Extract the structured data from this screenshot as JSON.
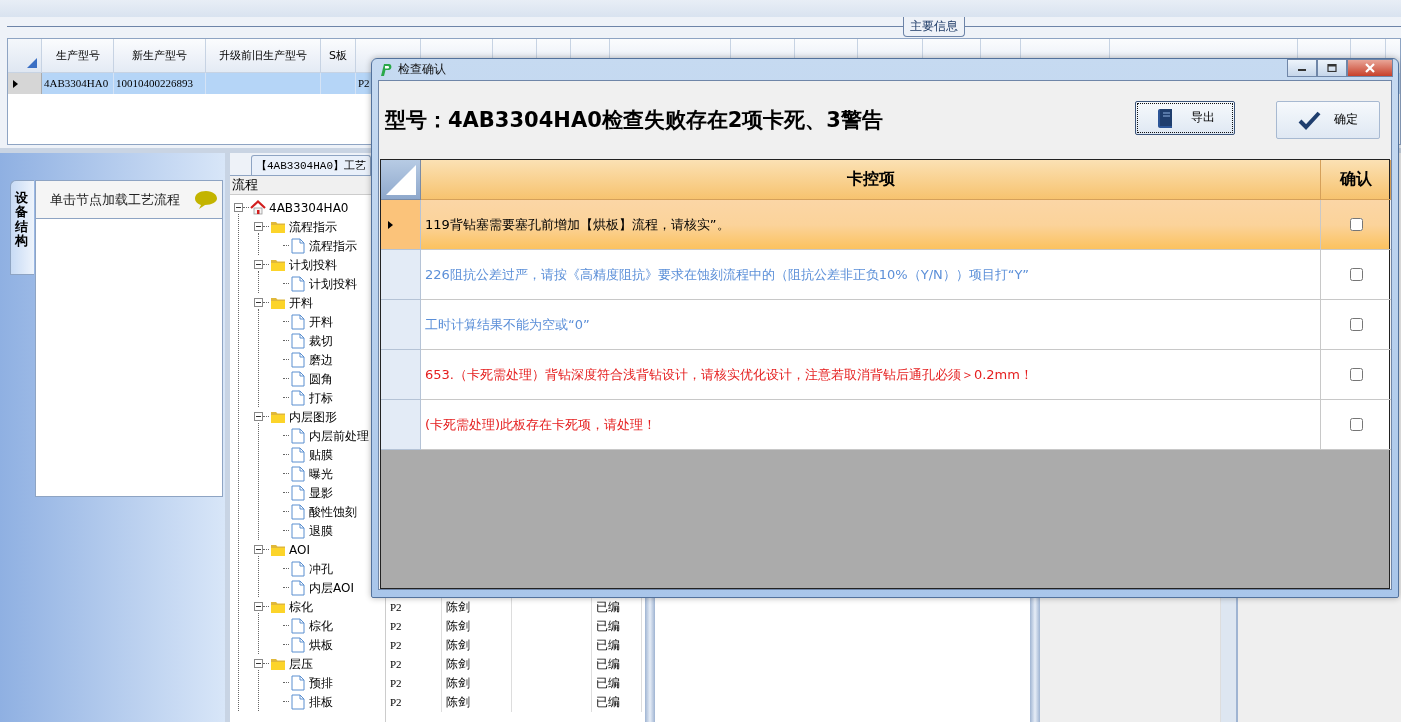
{
  "main_info": {
    "title": "主要信息",
    "columns": [
      "生产型号",
      "新生产型号",
      "升级前旧生产型号",
      "S板"
    ],
    "rows": [
      {
        "selected": true,
        "cells": [
          "4AB3304HA0",
          "10010400226893",
          "",
          "",
          "P2"
        ]
      }
    ]
  },
  "side_tab": {
    "label": "设备结构"
  },
  "node_panel": {
    "hint": "单击节点加载工艺流程"
  },
  "process_tab": {
    "label": "【4AB3304HA0】工艺"
  },
  "tree": {
    "header": "流程",
    "nodes": [
      {
        "label": "4AB3304HA0",
        "kind": "root",
        "expanded": true,
        "children": [
          {
            "label": "流程指示",
            "kind": "group",
            "expanded": true,
            "children": [
              {
                "label": "流程指示",
                "kind": "step"
              }
            ]
          },
          {
            "label": "计划投料",
            "kind": "group",
            "expanded": true,
            "children": [
              {
                "label": "计划投料",
                "kind": "step"
              }
            ]
          },
          {
            "label": "开料",
            "kind": "group",
            "expanded": true,
            "children": [
              {
                "label": "开料",
                "kind": "step"
              },
              {
                "label": "裁切",
                "kind": "step"
              },
              {
                "label": "磨边",
                "kind": "step"
              },
              {
                "label": "圆角",
                "kind": "step"
              },
              {
                "label": "打标",
                "kind": "step"
              }
            ]
          },
          {
            "label": "内层图形",
            "kind": "group",
            "expanded": true,
            "children": [
              {
                "label": "内层前处理",
                "kind": "step"
              },
              {
                "label": "贴膜",
                "kind": "step"
              },
              {
                "label": "曝光",
                "kind": "step"
              },
              {
                "label": "显影",
                "kind": "step"
              },
              {
                "label": "酸性蚀刻",
                "kind": "step"
              },
              {
                "label": "退膜",
                "kind": "step"
              }
            ]
          },
          {
            "label": "AOI",
            "kind": "group",
            "expanded": true,
            "children": [
              {
                "label": "冲孔",
                "kind": "step"
              },
              {
                "label": "内层AOI",
                "kind": "step"
              }
            ]
          },
          {
            "label": "棕化",
            "kind": "group",
            "expanded": true,
            "children": [
              {
                "label": "棕化",
                "kind": "step"
              },
              {
                "label": "烘板",
                "kind": "step"
              }
            ]
          },
          {
            "label": "层压",
            "kind": "group",
            "expanded": true,
            "children": [
              {
                "label": "预排",
                "kind": "step"
              },
              {
                "label": "排板",
                "kind": "step"
              }
            ]
          }
        ]
      }
    ]
  },
  "process_grid": {
    "rows": [
      {
        "column_1": "P2",
        "column_2": "陈剑",
        "column_4": "已编"
      },
      {
        "column_1": "P2",
        "column_2": "陈剑",
        "column_4": "已编"
      },
      {
        "column_1": "P2",
        "column_2": "陈剑",
        "column_4": "已编"
      },
      {
        "column_1": "P2",
        "column_2": "陈剑",
        "column_4": "已编"
      },
      {
        "column_1": "P2",
        "column_2": "陈剑",
        "column_4": "已编"
      },
      {
        "column_1": "P2",
        "column_2": "陈剑",
        "column_4": "已编"
      }
    ]
  },
  "dialog": {
    "title": "检查确认",
    "heading": "型号：4AB3304HA0检查失败存在2项卡死、3警告",
    "buttons": [
      {
        "label": "导出",
        "kind": "export",
        "focused": true
      },
      {
        "label": "确定",
        "kind": "confirm",
        "focused": false
      }
    ],
    "table": {
      "columns": [
        "卡控项",
        "确认"
      ],
      "rows": [
        {
          "text": "119背钻塞需要塞孔前增加【烘板】流程，请核实”。",
          "color": "#000000",
          "selected": true,
          "checked": false
        },
        {
          "text": "226阻抗公差过严，请按《高精度阻抗》要求在蚀刻流程中的（阻抗公差非正负10%（Y/N））项目打“Y”",
          "color": "#5b8fd8",
          "selected": false,
          "checked": false
        },
        {
          "text": "工时计算结果不能为空或“0”",
          "color": "#5b8fd8",
          "selected": false,
          "checked": false
        },
        {
          "text": "653.（卡死需处理）背钻深度符合浅背钻设计，请核实优化设计，注意若取消背钻后通孔必须＞0.2mm！",
          "color": "#e51e1e",
          "selected": false,
          "checked": false
        },
        {
          "text": "(卡死需处理)此板存在卡死项，请处理！",
          "color": "#e51e1e",
          "selected": false,
          "checked": false
        }
      ]
    }
  }
}
